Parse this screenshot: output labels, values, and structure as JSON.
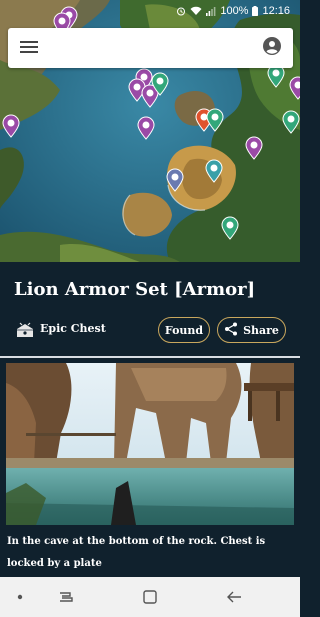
{
  "status_bar": {
    "battery": "100%",
    "time": "12:16",
    "icons": [
      "alarm-icon",
      "wifi-icon",
      "signal-icon",
      "battery-icon"
    ]
  },
  "app_bar": {
    "menu_icon": "menu-icon",
    "account_icon": "account-icon"
  },
  "map": {
    "colors": {
      "water": "#2c6f8c",
      "land": "#c79a4a",
      "forest": "#2f5d2a",
      "pin_purple": "#9a4aa6",
      "pin_green": "#33a77a",
      "pin_red": "#e0532e",
      "pin_teal": "#3aa0a8"
    },
    "pins": [
      {
        "type": "chest",
        "color": "purple"
      },
      {
        "type": "chest",
        "color": "purple"
      },
      {
        "type": "chest",
        "color": "purple"
      },
      {
        "type": "chest",
        "color": "purple"
      },
      {
        "type": "chest",
        "color": "purple"
      },
      {
        "type": "chest",
        "color": "purple"
      },
      {
        "type": "chest",
        "color": "purple"
      },
      {
        "type": "chest",
        "color": "purple"
      },
      {
        "type": "chest",
        "color": "purple"
      },
      {
        "type": "chest",
        "color": "purple"
      },
      {
        "type": "resource",
        "color": "green"
      },
      {
        "type": "resource",
        "color": "green"
      },
      {
        "type": "resource",
        "color": "green"
      },
      {
        "type": "selected",
        "color": "red"
      },
      {
        "type": "resource",
        "color": "teal"
      },
      {
        "type": "resource",
        "color": "green"
      }
    ]
  },
  "item": {
    "title": "Lion Armor Set [Armor]",
    "category": "Epic Chest",
    "category_icon": "chest-icon",
    "found_label": "Found",
    "share_label": "Share",
    "share_icon": "share-icon"
  },
  "photo": {
    "caption": "In the cave at the bottom of the rock.  Chest is locked by a plate"
  },
  "nav_bar": {
    "icons": [
      "dot-icon",
      "recent-apps-icon",
      "home-icon",
      "back-icon"
    ]
  }
}
